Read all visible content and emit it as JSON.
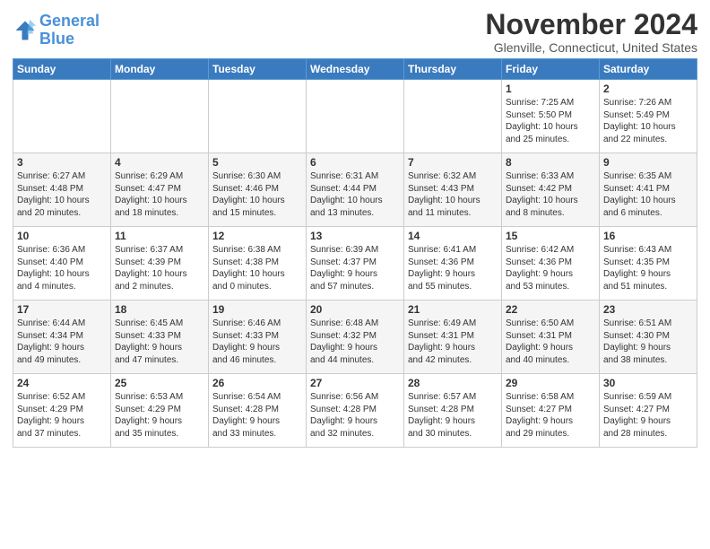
{
  "header": {
    "logo_line1": "General",
    "logo_line2": "Blue",
    "month_title": "November 2024",
    "location": "Glenville, Connecticut, United States"
  },
  "days_of_week": [
    "Sunday",
    "Monday",
    "Tuesday",
    "Wednesday",
    "Thursday",
    "Friday",
    "Saturday"
  ],
  "weeks": [
    {
      "days": [
        {
          "num": "",
          "info": ""
        },
        {
          "num": "",
          "info": ""
        },
        {
          "num": "",
          "info": ""
        },
        {
          "num": "",
          "info": ""
        },
        {
          "num": "",
          "info": ""
        },
        {
          "num": "1",
          "info": "Sunrise: 7:25 AM\nSunset: 5:50 PM\nDaylight: 10 hours\nand 25 minutes."
        },
        {
          "num": "2",
          "info": "Sunrise: 7:26 AM\nSunset: 5:49 PM\nDaylight: 10 hours\nand 22 minutes."
        }
      ]
    },
    {
      "days": [
        {
          "num": "3",
          "info": "Sunrise: 6:27 AM\nSunset: 4:48 PM\nDaylight: 10 hours\nand 20 minutes."
        },
        {
          "num": "4",
          "info": "Sunrise: 6:29 AM\nSunset: 4:47 PM\nDaylight: 10 hours\nand 18 minutes."
        },
        {
          "num": "5",
          "info": "Sunrise: 6:30 AM\nSunset: 4:46 PM\nDaylight: 10 hours\nand 15 minutes."
        },
        {
          "num": "6",
          "info": "Sunrise: 6:31 AM\nSunset: 4:44 PM\nDaylight: 10 hours\nand 13 minutes."
        },
        {
          "num": "7",
          "info": "Sunrise: 6:32 AM\nSunset: 4:43 PM\nDaylight: 10 hours\nand 11 minutes."
        },
        {
          "num": "8",
          "info": "Sunrise: 6:33 AM\nSunset: 4:42 PM\nDaylight: 10 hours\nand 8 minutes."
        },
        {
          "num": "9",
          "info": "Sunrise: 6:35 AM\nSunset: 4:41 PM\nDaylight: 10 hours\nand 6 minutes."
        }
      ]
    },
    {
      "days": [
        {
          "num": "10",
          "info": "Sunrise: 6:36 AM\nSunset: 4:40 PM\nDaylight: 10 hours\nand 4 minutes."
        },
        {
          "num": "11",
          "info": "Sunrise: 6:37 AM\nSunset: 4:39 PM\nDaylight: 10 hours\nand 2 minutes."
        },
        {
          "num": "12",
          "info": "Sunrise: 6:38 AM\nSunset: 4:38 PM\nDaylight: 10 hours\nand 0 minutes."
        },
        {
          "num": "13",
          "info": "Sunrise: 6:39 AM\nSunset: 4:37 PM\nDaylight: 9 hours\nand 57 minutes."
        },
        {
          "num": "14",
          "info": "Sunrise: 6:41 AM\nSunset: 4:36 PM\nDaylight: 9 hours\nand 55 minutes."
        },
        {
          "num": "15",
          "info": "Sunrise: 6:42 AM\nSunset: 4:36 PM\nDaylight: 9 hours\nand 53 minutes."
        },
        {
          "num": "16",
          "info": "Sunrise: 6:43 AM\nSunset: 4:35 PM\nDaylight: 9 hours\nand 51 minutes."
        }
      ]
    },
    {
      "days": [
        {
          "num": "17",
          "info": "Sunrise: 6:44 AM\nSunset: 4:34 PM\nDaylight: 9 hours\nand 49 minutes."
        },
        {
          "num": "18",
          "info": "Sunrise: 6:45 AM\nSunset: 4:33 PM\nDaylight: 9 hours\nand 47 minutes."
        },
        {
          "num": "19",
          "info": "Sunrise: 6:46 AM\nSunset: 4:33 PM\nDaylight: 9 hours\nand 46 minutes."
        },
        {
          "num": "20",
          "info": "Sunrise: 6:48 AM\nSunset: 4:32 PM\nDaylight: 9 hours\nand 44 minutes."
        },
        {
          "num": "21",
          "info": "Sunrise: 6:49 AM\nSunset: 4:31 PM\nDaylight: 9 hours\nand 42 minutes."
        },
        {
          "num": "22",
          "info": "Sunrise: 6:50 AM\nSunset: 4:31 PM\nDaylight: 9 hours\nand 40 minutes."
        },
        {
          "num": "23",
          "info": "Sunrise: 6:51 AM\nSunset: 4:30 PM\nDaylight: 9 hours\nand 38 minutes."
        }
      ]
    },
    {
      "days": [
        {
          "num": "24",
          "info": "Sunrise: 6:52 AM\nSunset: 4:29 PM\nDaylight: 9 hours\nand 37 minutes."
        },
        {
          "num": "25",
          "info": "Sunrise: 6:53 AM\nSunset: 4:29 PM\nDaylight: 9 hours\nand 35 minutes."
        },
        {
          "num": "26",
          "info": "Sunrise: 6:54 AM\nSunset: 4:28 PM\nDaylight: 9 hours\nand 33 minutes."
        },
        {
          "num": "27",
          "info": "Sunrise: 6:56 AM\nSunset: 4:28 PM\nDaylight: 9 hours\nand 32 minutes."
        },
        {
          "num": "28",
          "info": "Sunrise: 6:57 AM\nSunset: 4:28 PM\nDaylight: 9 hours\nand 30 minutes."
        },
        {
          "num": "29",
          "info": "Sunrise: 6:58 AM\nSunset: 4:27 PM\nDaylight: 9 hours\nand 29 minutes."
        },
        {
          "num": "30",
          "info": "Sunrise: 6:59 AM\nSunset: 4:27 PM\nDaylight: 9 hours\nand 28 minutes."
        }
      ]
    }
  ]
}
